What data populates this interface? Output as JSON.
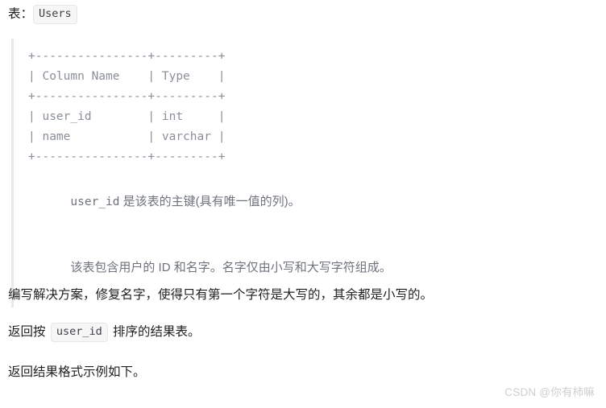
{
  "header": {
    "label": "表：",
    "table_name": "Users"
  },
  "schema_block": {
    "ascii_table": "+----------------+---------+\n| Column Name    | Type    |\n+----------------+---------+\n| user_id        | int     |\n| name           | varchar |\n+----------------+---------+",
    "notes": [
      {
        "code": "user_id",
        "text": " 是该表的主键(具有唯一值的列)。"
      },
      {
        "code": "",
        "text": "该表包含用户的 ID 和名字。名字仅由小写和大写字符组成。"
      }
    ]
  },
  "body": {
    "paragraph_1": "编写解决方案，修复名字，使得只有第一个字符是大写的，其余都是小写的。",
    "paragraph_2_prefix": "返回按 ",
    "paragraph_2_code": "user_id",
    "paragraph_2_suffix": " 排序的结果表。",
    "paragraph_3": "返回结果格式示例如下。"
  },
  "watermark": {
    "text": "CSDN @你有柿嘛"
  },
  "colors": {
    "background": "#ffffff",
    "body_text": "#1f1f1f",
    "muted_text": "#6e737b",
    "ascii_text": "#8a8f98",
    "code_badge_bg": "#f6f6f6",
    "code_badge_border": "#e7e7e7",
    "quote_border": "#e8e8e8",
    "watermark": "#cfcfcf"
  }
}
